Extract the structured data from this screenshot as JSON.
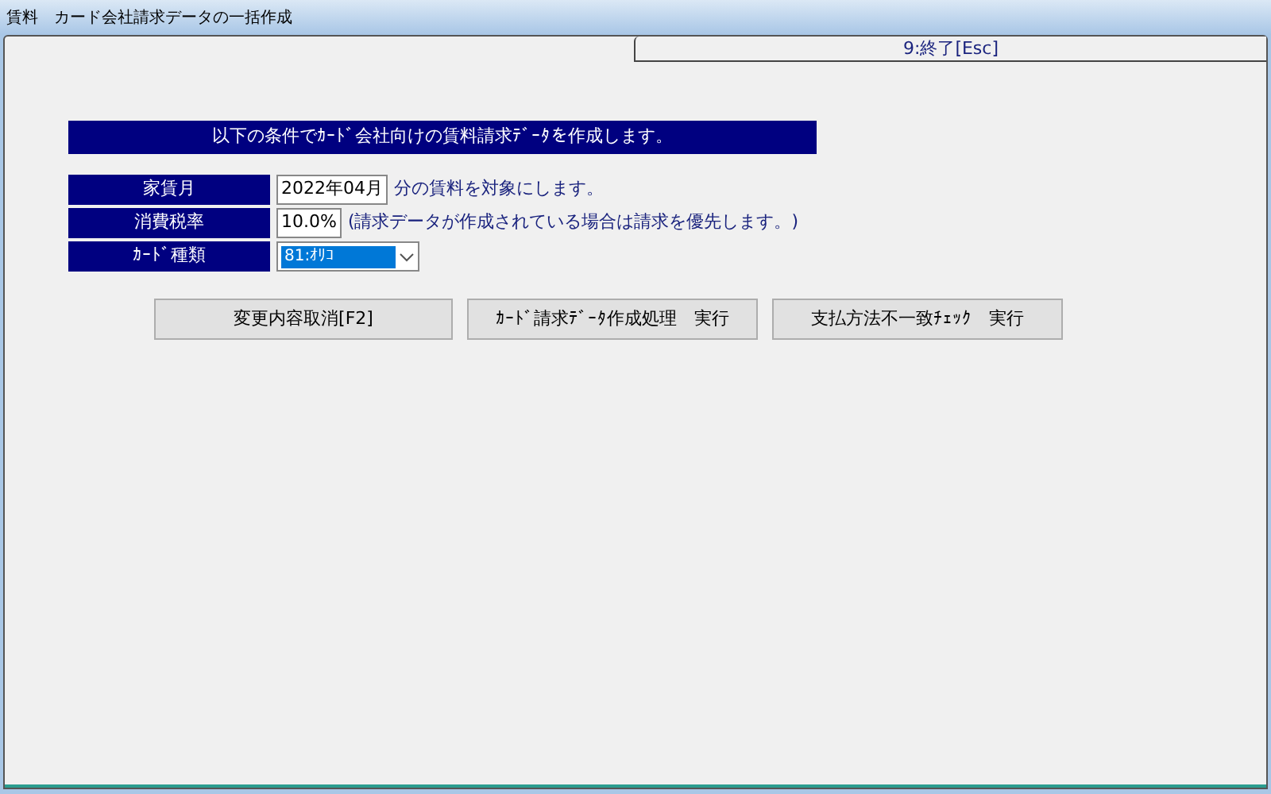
{
  "window": {
    "title": "賃料　カード会社請求データの一括作成"
  },
  "tab": {
    "label": "9:終了[Esc]"
  },
  "banner": "以下の条件でｶｰﾄﾞ会社向けの賃料請求ﾃﾞｰﾀを作成します。",
  "fields": [
    {
      "kind": "text",
      "label": "家賃月",
      "value": "2022年04月",
      "note": "分の賃料を対象にします。"
    },
    {
      "kind": "text",
      "label": "消費税率",
      "value": "10.0%",
      "note": "(請求データが作成されている場合は請求を優先します。)"
    },
    {
      "kind": "select",
      "label": "ｶｰﾄﾞ種類",
      "value": "81:ｵﾘｺ",
      "highlighted": true
    }
  ],
  "buttons": [
    "変更内容取消[F2]",
    "ｶｰﾄﾞ請求ﾃﾞｰﾀ作成処理　実行",
    "支払方法不一致ﾁｪｯｸ　実行"
  ]
}
